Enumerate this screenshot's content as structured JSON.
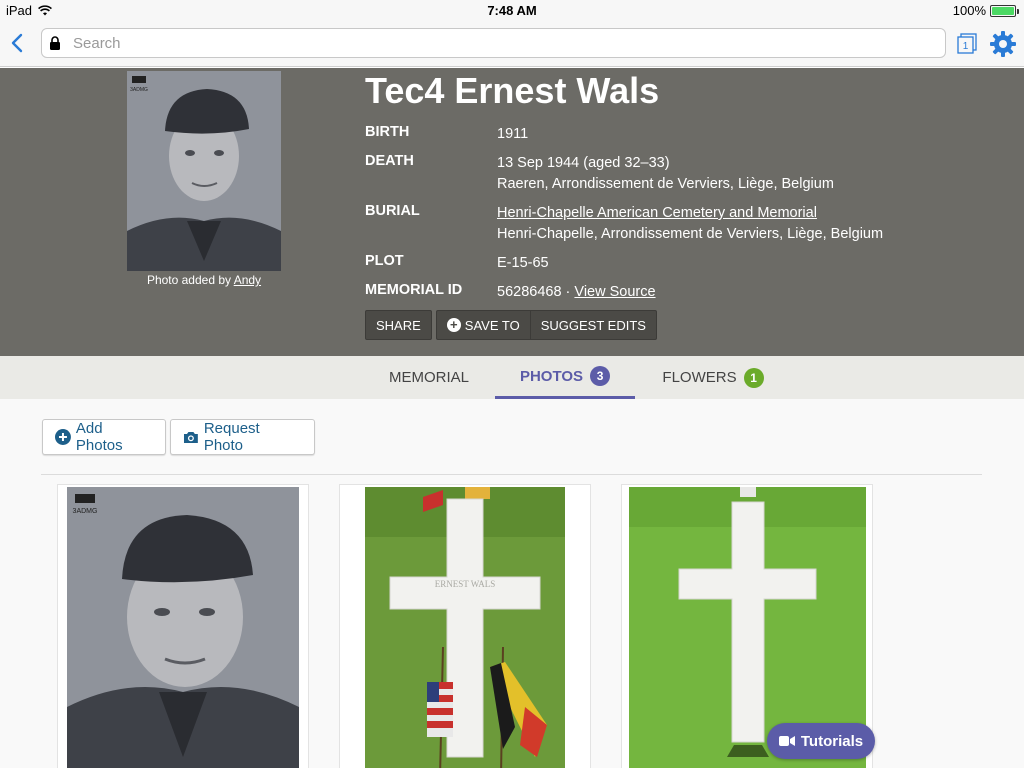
{
  "status_bar": {
    "device": "iPad",
    "time": "7:48 AM",
    "battery": "100%"
  },
  "nav": {
    "search_placeholder": "Search",
    "tab_count": "1"
  },
  "memorial": {
    "name": "Tec4 Ernest Wals",
    "photo_caption_prefix": "Photo added by ",
    "photo_caption_user": "Andy",
    "portrait_badge": "3ADMG",
    "facts": {
      "birth_label": "BIRTH",
      "birth_value": "1911",
      "death_label": "DEATH",
      "death_value": "13 Sep 1944 (aged 32–33)",
      "death_place": "Raeren, Arrondissement de Verviers, Liège, Belgium",
      "burial_label": "BURIAL",
      "burial_cemetery": "Henri-Chapelle American Cemetery and Memorial",
      "burial_place": "Henri-Chapelle, Arrondissement de Verviers, Liège, Belgium",
      "plot_label": "PLOT",
      "plot_value": "E-15-65",
      "memorial_id_label": "MEMORIAL ID",
      "memorial_id_value": "56286468",
      "memorial_id_separator": "·",
      "view_source": "View Source"
    },
    "actions": {
      "share": "SHARE",
      "save_to": "SAVE TO",
      "suggest_edits": "SUGGEST EDITS"
    }
  },
  "tabs": [
    {
      "label": "MEMORIAL",
      "count": null
    },
    {
      "label": "PHOTOS",
      "count": "3",
      "active": true
    },
    {
      "label": "FLOWERS",
      "count": "1"
    }
  ],
  "colors": {
    "photos_badge": "#5c5ca8",
    "flowers_badge": "#6bab2a",
    "header_bg": "#6c6b66",
    "accent": "#5b5ca8"
  },
  "photos_section": {
    "add_photos": "Add Photos",
    "request_photo": "Request Photo",
    "photo1_badge": "3ADMG",
    "cross_inscription_1": "ERNEST WALS"
  },
  "tutorials_label": "Tutorials"
}
